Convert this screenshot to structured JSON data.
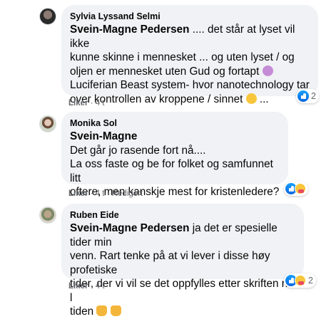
{
  "comments": [
    {
      "author": "Sylvia Lyssand Selmi",
      "mention": "Svein-Magne Pedersen",
      "text_line1_rest": " .... det står at lyset vil ikke",
      "text_line2": "kunne skinne i mennesket ... og uten lyset / og",
      "text_line3": "oljen er mennesket uten Gud og fortapt",
      "text_line4": "Luciferian Beast system- hvor nanotechnology tar",
      "text_line5": "over kontrollen av kroppene / sinnet",
      "text_line5_tail": " ...",
      "emojis": [
        "confounded-face",
        "crying-face"
      ],
      "like_label": "Liker",
      "meta": " · 4 t",
      "reactions": [
        "like"
      ],
      "reaction_count": "2"
    },
    {
      "author": "Monika Sol",
      "mention": "Svein-Magne",
      "text_line2": "Det går jo rasende fort nå....",
      "text_line3": "La oss faste og be for folket og samfunnet litt",
      "text_line4": "oftere, men kanskje mest for kristenledere?",
      "like_label": "Liker",
      "meta": " · 4 t · Redigert",
      "reactions": [
        "like",
        "care"
      ],
      "reaction_count": ""
    },
    {
      "author": "Ruben Eide",
      "mention": "Svein-Magne Pedersen",
      "text_line1_rest": " ja det er spesielle tider min",
      "text_line2": "venn. Rart tenke på at vi lever i disse høy profetiske",
      "text_line3": "tider, der vi vil se det oppfylles etter skriften no l",
      "text_line4": "tiden",
      "emojis": [
        "folded-hands",
        "folded-hands"
      ],
      "like_label": "Liker",
      "meta": " · 4 t",
      "reactions": [
        "like",
        "care"
      ],
      "reaction_count": "2"
    }
  ]
}
